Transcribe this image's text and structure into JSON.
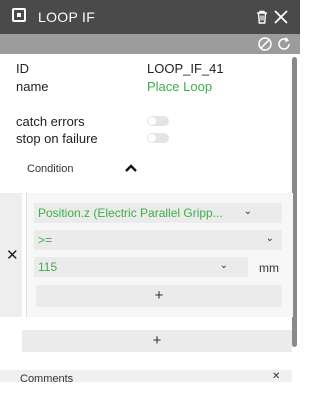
{
  "window": {
    "title": "LOOP IF"
  },
  "properties": {
    "id_label": "ID",
    "id_value": "LOOP_IF_41",
    "name_label": "name",
    "name_value": "Place Loop",
    "catch_errors_label": "catch errors",
    "stop_on_failure_label": "stop on failure"
  },
  "condition": {
    "section_label": "Condition",
    "variable": "Position.z (Electric Parallel Gripp...",
    "operator": ">=",
    "value": "115",
    "unit": "mm",
    "add_condition_label": "+",
    "remove_label": "✕"
  },
  "add_label": "+",
  "comments": {
    "label": "Comments"
  },
  "colors": {
    "titlebar": "#4a4a4a",
    "toolbar": "#9c9c9c",
    "accent_green": "#3fae4a"
  },
  "icons": {
    "title": "node-icon",
    "delete": "trash-icon",
    "close": "close-icon",
    "disable": "disable-icon",
    "reset": "reset-icon",
    "collapse": "caret-up-icon",
    "dropdown": "chevron-down-icon"
  }
}
